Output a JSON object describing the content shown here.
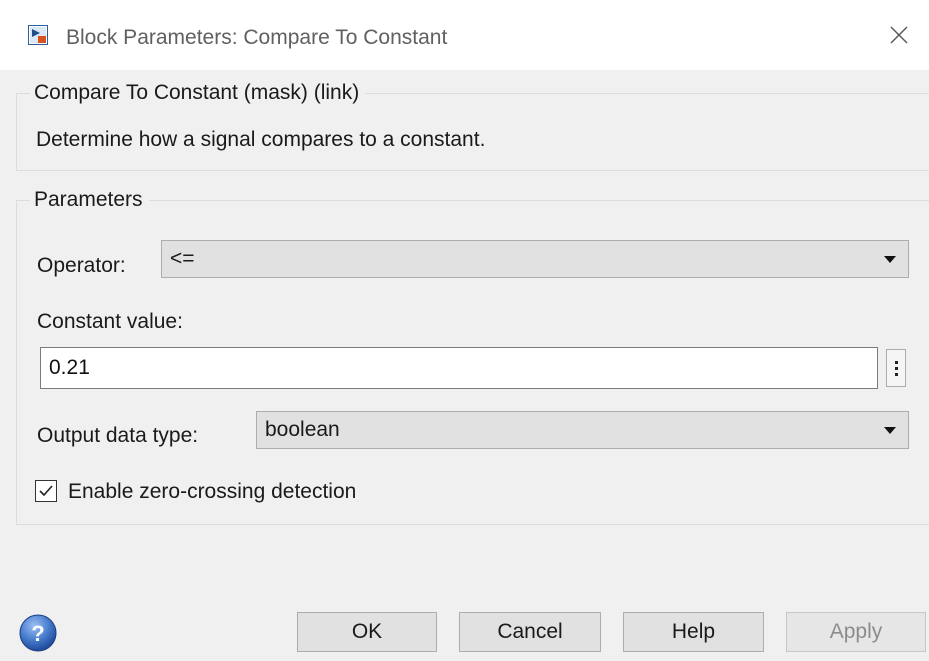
{
  "window": {
    "title": "Block Parameters: Compare To Constant",
    "icon": "simulink-block-icon",
    "close_icon": "close-icon"
  },
  "description_group": {
    "legend": "Compare To Constant (mask) (link)",
    "text": "Determine how a signal compares to a constant."
  },
  "parameters_group": {
    "legend": "Parameters",
    "operator": {
      "label": "Operator:",
      "value": "<="
    },
    "constant": {
      "label": "Constant value:",
      "value": "0.21"
    },
    "output_type": {
      "label": "Output data type:",
      "value": "boolean"
    },
    "zero_crossing": {
      "label": "Enable zero-crossing detection",
      "checked": true
    }
  },
  "footer": {
    "help_icon": "question-mark-icon",
    "ok": "OK",
    "cancel": "Cancel",
    "help": "Help",
    "apply": "Apply"
  },
  "colors": {
    "background": "#f0f0f0",
    "button_face": "#e1e1e1",
    "disabled_text": "#8c8c8c",
    "help_icon_blue": "#3a6fc4"
  }
}
